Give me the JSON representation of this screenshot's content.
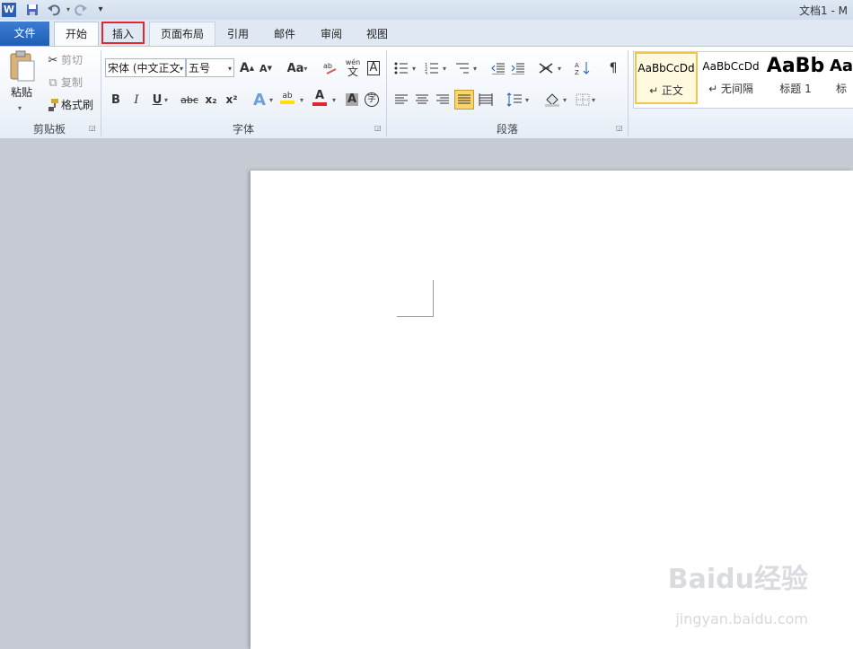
{
  "window": {
    "title": "文档1 - M"
  },
  "tabs": [
    {
      "label": "文件"
    },
    {
      "label": "开始"
    },
    {
      "label": "插入"
    },
    {
      "label": "页面布局"
    },
    {
      "label": "引用"
    },
    {
      "label": "邮件"
    },
    {
      "label": "审阅"
    },
    {
      "label": "视图"
    }
  ],
  "clipboard": {
    "paste_label": "粘贴",
    "cut_label": "剪切",
    "copy_label": "复制",
    "format_painter_label": "格式刷",
    "group_label": "剪贴板"
  },
  "font": {
    "font_name": "宋体 (中文正文)",
    "font_size": "五号",
    "group_label": "字体",
    "grow_icon_text": "A",
    "change_case_text": "Aa",
    "bold": "B",
    "italic": "I",
    "underline": "U",
    "strike": "abc",
    "subscript": "x₂",
    "superscript": "x²",
    "wen_text": "wén",
    "wen_char": "文",
    "font_color_text": "A",
    "char_shading_text": "A",
    "enclose_char": "字",
    "highlight_text": "ab"
  },
  "paragraph": {
    "group_label": "段落"
  },
  "styles": [
    {
      "sample": "AaBbCcDd",
      "name": "↵ 正文"
    },
    {
      "sample": "AaBbCcDd",
      "name": "↵ 无间隔"
    },
    {
      "sample": "AaBb",
      "name": "标题 1"
    },
    {
      "sample": "Aa",
      "name": "标"
    }
  ],
  "watermark": {
    "text": "Baidu经验",
    "sub": "jingyan.baidu.com"
  },
  "colors": {
    "highlight_red": "#e3262d",
    "file_tab": "#2a68c0",
    "font_color_bar": "#e3262d",
    "highlight_bar": "#ffe100"
  }
}
